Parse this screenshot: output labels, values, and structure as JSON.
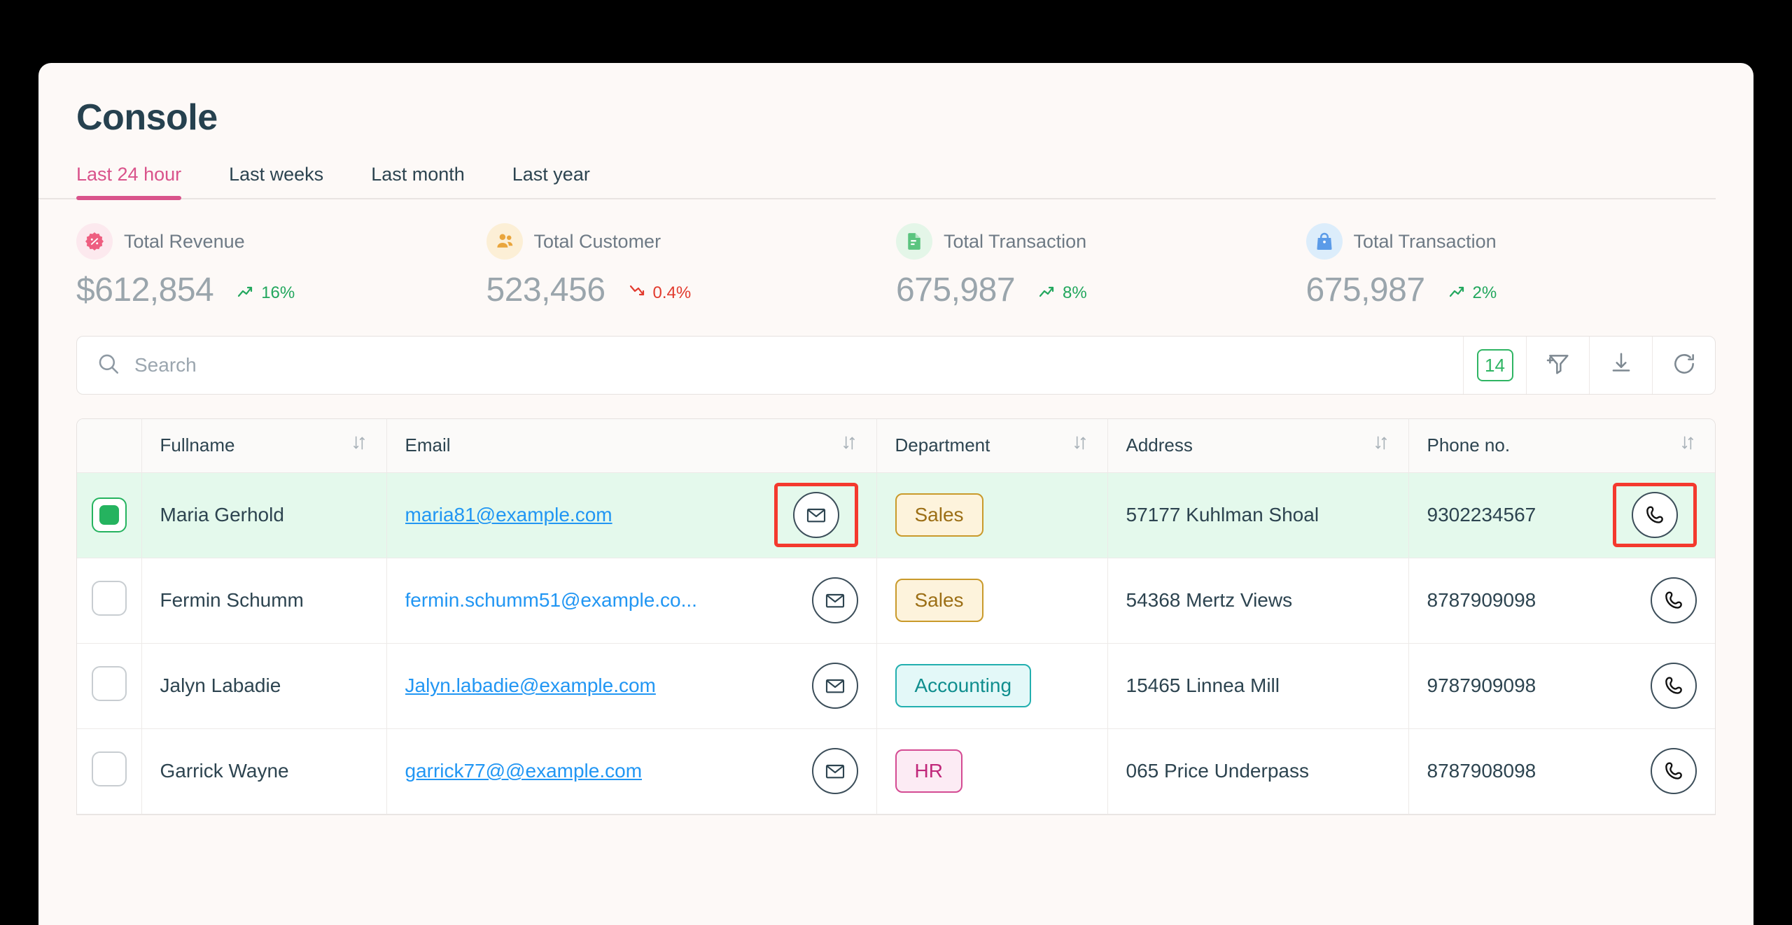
{
  "header": {
    "title": "Console"
  },
  "tabs": [
    {
      "label": "Last 24 hour",
      "active": true
    },
    {
      "label": "Last weeks",
      "active": false
    },
    {
      "label": "Last month",
      "active": false
    },
    {
      "label": "Last year",
      "active": false
    }
  ],
  "stats": [
    {
      "icon": "percent-badge-icon",
      "label": "Total Revenue",
      "value": "$612,854",
      "delta": "16%",
      "direction": "up",
      "icon_color": "#EE5E80",
      "icon_bg": "#FCE9EE"
    },
    {
      "icon": "users-icon",
      "label": "Total Customer",
      "value": "523,456",
      "delta": "0.4%",
      "direction": "down",
      "icon_color": "#E9A53C",
      "icon_bg": "#FCEFD6"
    },
    {
      "icon": "document-icon",
      "label": "Total Transaction",
      "value": "675,987",
      "delta": "8%",
      "direction": "up",
      "icon_color": "#5BC47F",
      "icon_bg": "#E4F6E8"
    },
    {
      "icon": "bag-icon",
      "label": "Total Transaction",
      "value": "675,987",
      "delta": "2%",
      "direction": "up",
      "icon_color": "#5B9BE8",
      "icon_bg": "#DCEDFB"
    }
  ],
  "search": {
    "placeholder": "Search",
    "value": ""
  },
  "toolbar": {
    "count": "14",
    "filter_label": "filter-add-icon",
    "download_label": "download-icon",
    "refresh_label": "refresh-icon"
  },
  "table": {
    "columns": [
      {
        "key": "fullname",
        "label": "Fullname",
        "sortable": true
      },
      {
        "key": "email",
        "label": "Email",
        "sortable": true
      },
      {
        "key": "department",
        "label": "Department",
        "sortable": true
      },
      {
        "key": "address",
        "label": "Address",
        "sortable": true
      },
      {
        "key": "phone",
        "label": "Phone no.",
        "sortable": true
      }
    ],
    "rows": [
      {
        "selected": true,
        "fullname": "Maria Gerhold",
        "email": "maria81@example.com",
        "email_truncated": false,
        "department": "Sales",
        "department_style": "sales",
        "address": "57177 Kuhlman Shoal",
        "phone": "9302234567",
        "mail_highlighted": true,
        "phone_highlighted": true
      },
      {
        "selected": false,
        "fullname": "Fermin Schumm",
        "email": "fermin.schumm51@example.co...",
        "email_truncated": true,
        "department": "Sales",
        "department_style": "sales",
        "address": "54368 Mertz Views",
        "phone": "8787909098",
        "mail_highlighted": false,
        "phone_highlighted": false
      },
      {
        "selected": false,
        "fullname": "Jalyn Labadie",
        "email": "Jalyn.labadie@example.com",
        "email_truncated": false,
        "department": "Accounting",
        "department_style": "accounting",
        "address": "15465 Linnea Mill",
        "phone": "9787909098",
        "mail_highlighted": false,
        "phone_highlighted": false
      },
      {
        "selected": false,
        "fullname": "Garrick Wayne",
        "email": "garrick77@@example.com",
        "email_truncated": false,
        "department": "HR",
        "department_style": "hr",
        "address": "065 Price Underpass",
        "phone": "8787908098",
        "mail_highlighted": false,
        "phone_highlighted": false
      }
    ]
  },
  "colors": {
    "accent": "#D9538B",
    "page_bg": "#FDF9F7",
    "selected_row": "#E4F9EC",
    "highlight": "#F4392E",
    "link": "#2196F3"
  }
}
